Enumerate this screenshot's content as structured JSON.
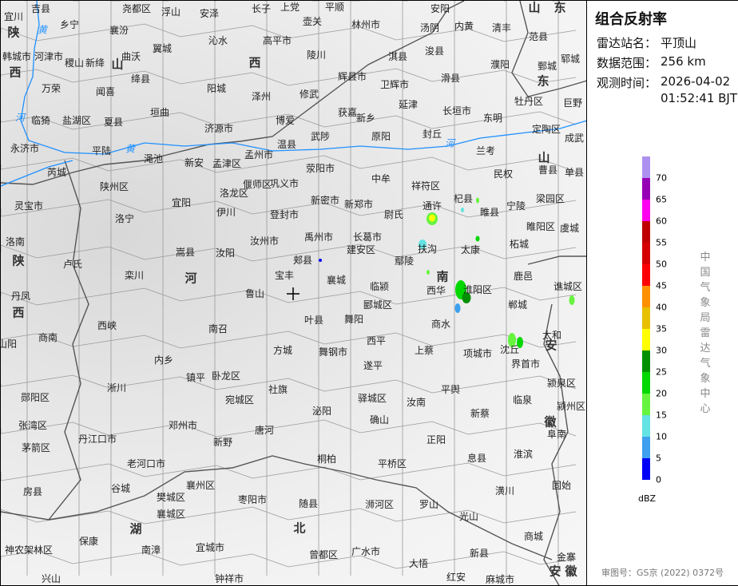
{
  "panel": {
    "title": "组合反射率",
    "station_label": "雷达站名：",
    "station": "平顶山",
    "range_label": "数据范围：",
    "range": "256 km",
    "time_label": "观测时间：",
    "date": "2026-04-02",
    "time": "01:52:41 BJT",
    "unit": "dBZ",
    "source": "中国气象局雷达气象中心",
    "approval": "审图号：GS京 (2022) 0372号"
  },
  "colorbar": {
    "ticks": [
      "0",
      "5",
      "10",
      "15",
      "20",
      "25",
      "30",
      "35",
      "40",
      "45",
      "50",
      "55",
      "60",
      "65",
      "70"
    ],
    "colors": [
      "#0000f6",
      "#3ea0ee",
      "#63e3e3",
      "#66f43e",
      "#00d800",
      "#009000",
      "#ffff00",
      "#e7c000",
      "#ff9000",
      "#ff0000",
      "#d60000",
      "#c00000",
      "#ff00f0",
      "#9600b4",
      "#ad90f0"
    ]
  },
  "map": {
    "province_labels": [
      "陕",
      "西",
      "山",
      "西",
      "河",
      "南",
      "山",
      "东",
      "山",
      "东",
      "安",
      "徽",
      "湖",
      "北",
      "陕",
      "西",
      "安",
      "徽"
    ],
    "river_labels": [
      "黄",
      "河",
      "黄",
      "河"
    ],
    "labels": [
      "吉县",
      "乡宁",
      "尧都区",
      "浮山",
      "安泽",
      "长子",
      "上党",
      "壶关",
      "平顺",
      "林州市",
      "安阳",
      "内黄",
      "清丰",
      "宜川",
      "襄汾",
      "翼城",
      "沁水",
      "高平市",
      "陵川",
      "汤阴",
      "浚县",
      "淇县",
      "濮阳",
      "范县",
      "郓城",
      "韩城市",
      "河津市",
      "稷山",
      "新绛",
      "曲沃",
      "万荣",
      "闻喜",
      "绛县",
      "阳城",
      "泽州",
      "修武",
      "辉县市",
      "卫辉市",
      "滑县",
      "鄄城",
      "牡丹区",
      "巨野",
      "临猗",
      "盐湖区",
      "夏县",
      "垣曲",
      "济源市",
      "博爱",
      "获嘉",
      "新乡",
      "延津",
      "长垣市",
      "东明",
      "定陶区",
      "成武",
      "永济市",
      "芮城",
      "平陆",
      "渑池",
      "新安",
      "孟津区",
      "孟州市",
      "温县",
      "武陟",
      "原阳",
      "封丘",
      "兰考",
      "曹县",
      "单县",
      "荥阳市",
      "偃师区",
      "巩义市",
      "中牟",
      "祥符区",
      "民权",
      "陕州区",
      "灵宝市",
      "洛龙区",
      "宜阳",
      "伊川",
      "新密市",
      "新郑市",
      "尉氏",
      "通许",
      "杞县",
      "睢县",
      "宁陵",
      "梁园区",
      "虞城",
      "洛宁",
      "登封市",
      "汝州市",
      "禹州市",
      "长葛市",
      "扶沟",
      "太康",
      "柘城",
      "睢阳区",
      "洛南",
      "卢氏",
      "嵩县",
      "汝阳",
      "郏县",
      "建安区",
      "鄢陵",
      "鹿邑",
      "栾川",
      "宝丰",
      "襄城",
      "临颍",
      "西华",
      "淮阳区",
      "谯城区",
      "丹凤",
      "鲁山",
      "郾城区",
      "郸城",
      "西峡",
      "南召",
      "叶县",
      "舞阳",
      "商水",
      "太和",
      "商南",
      "方城",
      "舞钢市",
      "西平",
      "上蔡",
      "项城市",
      "沈丘",
      "界首市",
      "内乡",
      "镇平",
      "卧龙区",
      "遂平",
      "颍泉区",
      "淅川",
      "宛城区",
      "社旗",
      "泌阳",
      "驿城区",
      "汝南",
      "平舆",
      "临泉",
      "颍州区",
      "郧阳区",
      "新蔡",
      "张湾区",
      "邓州市",
      "唐河",
      "确山",
      "阜南",
      "丹江口市",
      "茅箭区",
      "新野",
      "正阳",
      "老河口市",
      "桐柏",
      "平桥区",
      "息县",
      "淮滨",
      "谷城",
      "房县",
      "襄州区",
      "枣阳市",
      "随县",
      "浉河区",
      "罗山",
      "潢川",
      "固始",
      "樊城区",
      "襄城区",
      "光山",
      "商城",
      "神农架林区",
      "保康",
      "南漳",
      "宜城市",
      "曾都区",
      "广水市",
      "新县",
      "金寨",
      "兴山",
      "钟祥市",
      "大悟",
      "红安",
      "麻城市",
      "山阳"
    ]
  }
}
